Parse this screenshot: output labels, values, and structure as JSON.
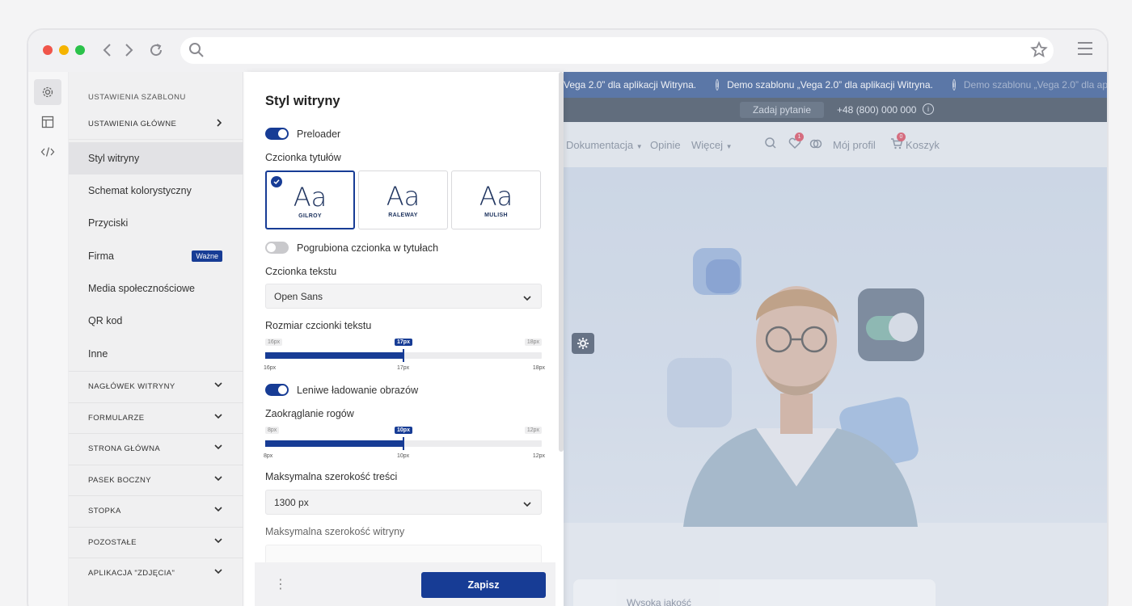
{
  "rail": {
    "icons": [
      "gear-icon",
      "layout-icon",
      "code-icon"
    ]
  },
  "settings": {
    "heading": "USTAWIENIA SZABLONU",
    "main_group": "USTAWIENIA GŁÓWNE",
    "items": [
      {
        "label": "Styl witryny"
      },
      {
        "label": "Schemat kolorystyczny"
      },
      {
        "label": "Przyciski"
      },
      {
        "label": "Firma",
        "tag": "Ważne"
      },
      {
        "label": "Media społecznościowe"
      },
      {
        "label": "QR kod"
      },
      {
        "label": "Inne"
      }
    ],
    "sections": [
      "NAGŁÓWEK WITRYNY",
      "FORMULARZE",
      "STRONA GŁÓWNA",
      "PASEK BOCZNY",
      "STOPKA",
      "POZOSTAŁE",
      "APLIKACJA \"ZDJĘCIA\""
    ]
  },
  "panel": {
    "title": "Styl witryny",
    "preloader": {
      "label": "Preloader",
      "on": true
    },
    "title_font_label": "Czcionka tytułów",
    "fonts": [
      {
        "sample": "Aa",
        "name": "GILROY",
        "selected": true
      },
      {
        "sample": "Aa",
        "name": "RALEWAY",
        "selected": false
      },
      {
        "sample": "Aa",
        "name": "MULISH",
        "selected": false
      }
    ],
    "bold_titles": {
      "label": "Pogrubiona czcionka w tytułach",
      "on": false
    },
    "text_font_label": "Czcionka tekstu",
    "text_font_value": "Open Sans",
    "font_size": {
      "label": "Rozmiar czcionki tekstu",
      "min": "16px",
      "current": "17px",
      "max": "18px",
      "fraction": 0.5
    },
    "lazy_load": {
      "label": "Leniwe ładowanie obrazów",
      "on": true
    },
    "radius": {
      "label": "Zaokrąglanie rogów",
      "min": "8px",
      "current": "10px",
      "max": "12px",
      "fraction": 0.5
    },
    "content_width_label": "Maksymalna szerokość treści",
    "content_width_value": "1300 px",
    "site_width_label": "Maksymalna szerokość witryny",
    "save": "Zapisz",
    "more": "⋮"
  },
  "site": {
    "announcement": "Demo szablonu „Vega 2.0” dla aplikacji Witryna.",
    "announcement_partial": "„Vega 2.0” dla aplikacji Witryna.",
    "ask": "Zadaj pytanie",
    "phone": "+48 (800) 000 000",
    "nav": {
      "docs": "Dokumentacja",
      "reviews": "Opinie",
      "more": "Więcej",
      "profile": "Mój profil",
      "cart": "Koszyk",
      "fav_count": "1",
      "cart_count": "0"
    },
    "card_title": "Wysoka jakość"
  },
  "colors": {
    "accent": "#173c95",
    "announce_bg": "#1d4488"
  }
}
